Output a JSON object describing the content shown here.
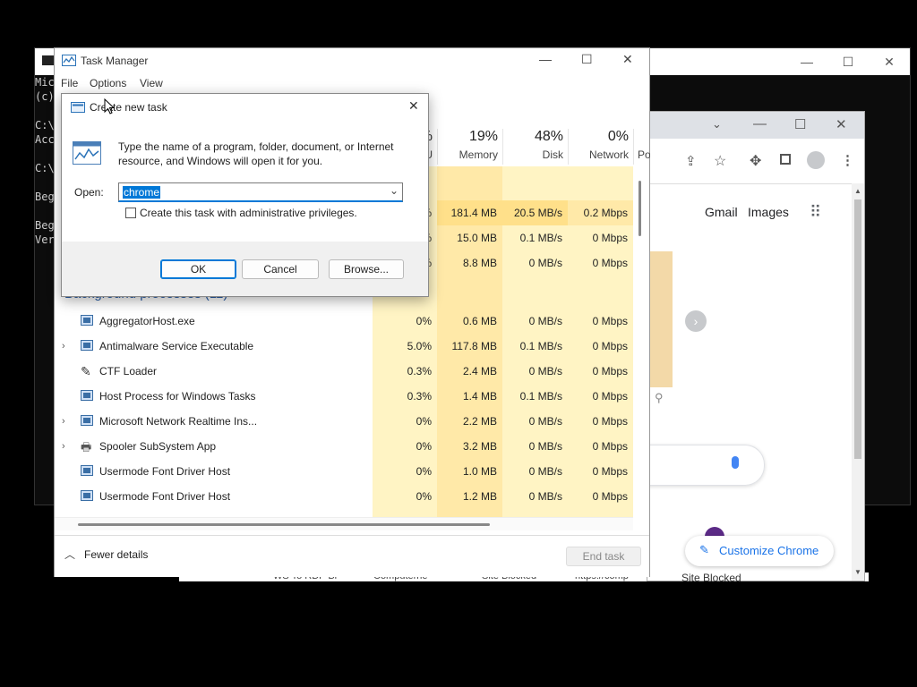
{
  "console": {
    "lines": [
      "Mic",
      "(c)",
      "C:\\",
      "Acc",
      "C:\\",
      "Beg",
      "Beg",
      "Ver"
    ]
  },
  "chrome": {
    "links": {
      "gmail": "Gmail",
      "images": "Images"
    },
    "customize": "Customize Chrome",
    "bottom_label": "Site Blocked"
  },
  "task_manager": {
    "title": "Task Manager",
    "menu": [
      "File",
      "Options",
      "View"
    ],
    "columns": [
      {
        "pct": "%",
        "label": "U"
      },
      {
        "pct": "19%",
        "label": "Memory"
      },
      {
        "pct": "48%",
        "label": "Disk"
      },
      {
        "pct": "0%",
        "label": "Network"
      },
      {
        "pct": "",
        "label": "Po"
      }
    ],
    "top_rows": [
      {
        "cpu": "%",
        "memory": "181.4 MB",
        "disk": "20.5 MB/s",
        "network": "0.2 Mbps"
      },
      {
        "cpu": "%",
        "memory": "15.0 MB",
        "disk": "0.1 MB/s",
        "network": "0 Mbps"
      },
      {
        "cpu": "%",
        "memory": "8.8 MB",
        "disk": "0 MB/s",
        "network": "0 Mbps"
      }
    ],
    "section_label": "Background processes (11)",
    "processes": [
      {
        "name": "AggregatorHost.exe",
        "cpu": "0%",
        "memory": "0.6 MB",
        "disk": "0 MB/s",
        "network": "0 Mbps",
        "expandable": false
      },
      {
        "name": "Antimalware Service Executable",
        "cpu": "5.0%",
        "memory": "117.8 MB",
        "disk": "0.1 MB/s",
        "network": "0 Mbps",
        "expandable": true
      },
      {
        "name": "CTF Loader",
        "cpu": "0.3%",
        "memory": "2.4 MB",
        "disk": "0 MB/s",
        "network": "0 Mbps",
        "expandable": false
      },
      {
        "name": "Host Process for Windows Tasks",
        "cpu": "0.3%",
        "memory": "1.4 MB",
        "disk": "0.1 MB/s",
        "network": "0 Mbps",
        "expandable": false
      },
      {
        "name": "Microsoft Network Realtime Ins...",
        "cpu": "0%",
        "memory": "2.2 MB",
        "disk": "0 MB/s",
        "network": "0 Mbps",
        "expandable": true
      },
      {
        "name": "Spooler SubSystem App",
        "cpu": "0%",
        "memory": "3.2 MB",
        "disk": "0 MB/s",
        "network": "0 Mbps",
        "expandable": true
      },
      {
        "name": "Usermode Font Driver Host",
        "cpu": "0%",
        "memory": "1.0 MB",
        "disk": "0 MB/s",
        "network": "0 Mbps",
        "expandable": false
      },
      {
        "name": "Usermode Font Driver Host",
        "cpu": "0%",
        "memory": "1.2 MB",
        "disk": "0 MB/s",
        "network": "0 Mbps",
        "expandable": false
      }
    ],
    "fewer_details": "Fewer details",
    "end_task": "End task"
  },
  "run_dialog": {
    "title": "Create new task",
    "description": "Type the name of a program, folder, document, or Internet resource, and Windows will open it for you.",
    "open_label": "Open:",
    "open_value": "chrome",
    "admin_checkbox_label": "Create this task with administrative privileges.",
    "admin_checked": false,
    "ok": "OK",
    "cancel": "Cancel",
    "browse": "Browse..."
  },
  "background_fragments": [
    "WS To RDP Bl",
    "Computerne",
    "Site Blocked",
    "https://comp",
    "Site Blocked"
  ],
  "colors": {
    "cpu_cell": "#fff4c4",
    "memory_cell": "#ffe9a8",
    "selection": "#0078d7",
    "accent_purple": "#5b2a86",
    "chrome_blue": "#1a73e8"
  }
}
